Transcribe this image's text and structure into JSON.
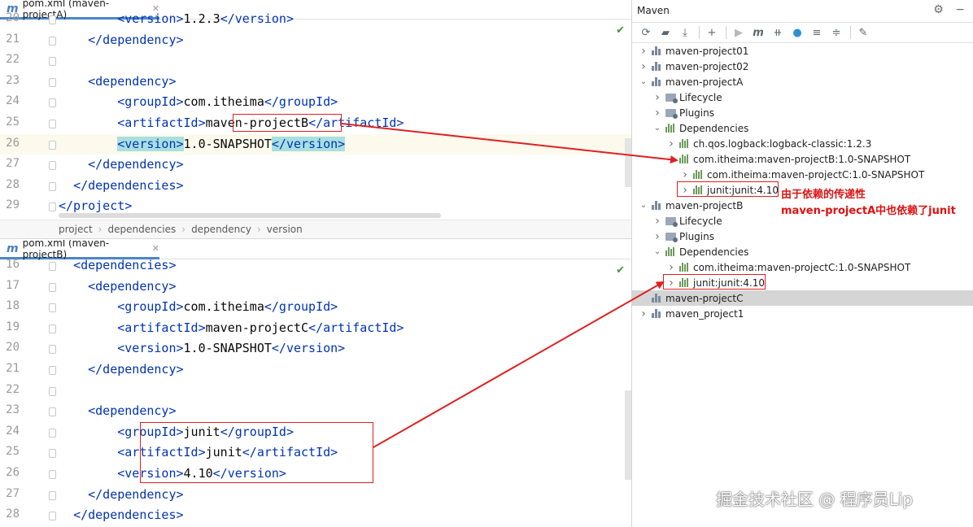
{
  "editor_a": {
    "tab_label": "pom.xml (maven-projectA)",
    "lines": [
      {
        "num": "20",
        "indent": "        ",
        "parts": [
          [
            "tag",
            "<version>"
          ],
          [
            "t",
            "1.2.3"
          ],
          [
            "tag",
            "</version>"
          ]
        ]
      },
      {
        "num": "21",
        "indent": "    ",
        "parts": [
          [
            "tag",
            "</dependency>"
          ]
        ]
      },
      {
        "num": "22",
        "indent": "",
        "parts": []
      },
      {
        "num": "23",
        "indent": "    ",
        "parts": [
          [
            "tag",
            "<dependency>"
          ]
        ]
      },
      {
        "num": "24",
        "indent": "        ",
        "parts": [
          [
            "tag",
            "<groupId>"
          ],
          [
            "t",
            "com.itheima"
          ],
          [
            "tag",
            "</groupId>"
          ]
        ]
      },
      {
        "num": "25",
        "indent": "        ",
        "parts": [
          [
            "tag",
            "<artifactId>"
          ],
          [
            "t",
            "maven-projectB"
          ],
          [
            "tag",
            "</artifactId>"
          ]
        ]
      },
      {
        "num": "26",
        "indent": "        ",
        "parts": [
          [
            "tagbg",
            "<version>"
          ],
          [
            "t",
            "1.0-SNAPSHOT"
          ],
          [
            "tagbg",
            "</version>"
          ]
        ]
      },
      {
        "num": "27",
        "indent": "    ",
        "parts": [
          [
            "tag",
            "</dependency>"
          ]
        ]
      },
      {
        "num": "28",
        "indent": "  ",
        "parts": [
          [
            "tag",
            "</dependencies>"
          ]
        ]
      },
      {
        "num": "29",
        "indent": "",
        "parts": [
          [
            "tag",
            "</project>"
          ]
        ]
      }
    ],
    "breadcrumb": [
      "project",
      "dependencies",
      "dependency",
      "version"
    ]
  },
  "editor_b": {
    "tab_label": "pom.xml (maven-projectB)",
    "lines": [
      {
        "num": "16",
        "indent": "  ",
        "parts": [
          [
            "tag",
            "<dependencies>"
          ]
        ]
      },
      {
        "num": "17",
        "indent": "    ",
        "parts": [
          [
            "tag",
            "<dependency>"
          ]
        ]
      },
      {
        "num": "18",
        "indent": "        ",
        "parts": [
          [
            "tag",
            "<groupId>"
          ],
          [
            "t",
            "com.itheima"
          ],
          [
            "tag",
            "</groupId>"
          ]
        ]
      },
      {
        "num": "19",
        "indent": "        ",
        "parts": [
          [
            "tag",
            "<artifactId>"
          ],
          [
            "t",
            "maven-projectC"
          ],
          [
            "tag",
            "</artifactId>"
          ]
        ]
      },
      {
        "num": "20",
        "indent": "        ",
        "parts": [
          [
            "tag",
            "<version>"
          ],
          [
            "t",
            "1.0-SNAPSHOT"
          ],
          [
            "tag",
            "</version>"
          ]
        ]
      },
      {
        "num": "21",
        "indent": "    ",
        "parts": [
          [
            "tag",
            "</dependency>"
          ]
        ]
      },
      {
        "num": "22",
        "indent": "",
        "parts": []
      },
      {
        "num": "23",
        "indent": "    ",
        "parts": [
          [
            "tag",
            "<dependency>"
          ]
        ]
      },
      {
        "num": "24",
        "indent": "        ",
        "parts": [
          [
            "tag",
            "<groupId>"
          ],
          [
            "t",
            "junit"
          ],
          [
            "tag",
            "</groupId>"
          ]
        ]
      },
      {
        "num": "25",
        "indent": "        ",
        "parts": [
          [
            "tag",
            "<artifactId>"
          ],
          [
            "t",
            "junit"
          ],
          [
            "tag",
            "</artifactId>"
          ]
        ]
      },
      {
        "num": "26",
        "indent": "        ",
        "parts": [
          [
            "tag",
            "<version>"
          ],
          [
            "t",
            "4.10"
          ],
          [
            "tag",
            "</version>"
          ]
        ]
      },
      {
        "num": "27",
        "indent": "    ",
        "parts": [
          [
            "tag",
            "</dependency>"
          ]
        ]
      },
      {
        "num": "28",
        "indent": "  ",
        "parts": [
          [
            "tag",
            "</dependencies>"
          ]
        ]
      }
    ]
  },
  "maven": {
    "title": "Maven",
    "toolbar_icons": [
      "reload-icon",
      "add-folder-icon",
      "download-icon",
      "plus-icon",
      "run-icon",
      "maven-goal-icon",
      "skip-tests-icon",
      "offline-icon",
      "collapse-icon",
      "expand-icon",
      "wrench-icon"
    ],
    "tree": [
      {
        "label": "maven-project01",
        "level": 0,
        "chev": ">",
        "icon": "module"
      },
      {
        "label": "maven-project02",
        "level": 0,
        "chev": ">",
        "icon": "module"
      },
      {
        "label": "maven-projectA",
        "level": 0,
        "chev": "v",
        "icon": "module"
      },
      {
        "label": "Lifecycle",
        "level": 1,
        "chev": ">",
        "icon": "folder"
      },
      {
        "label": "Plugins",
        "level": 1,
        "chev": ">",
        "icon": "folder"
      },
      {
        "label": "Dependencies",
        "level": 1,
        "chev": "v",
        "icon": "bars"
      },
      {
        "label": "ch.qos.logback:logback-classic:1.2.3",
        "level": 2,
        "chev": ">",
        "icon": "bars"
      },
      {
        "label": "com.itheima:maven-projectB:1.0-SNAPSHOT",
        "level": 2,
        "chev": "v",
        "icon": "bars"
      },
      {
        "label": "com.itheima:maven-projectC:1.0-SNAPSHOT",
        "level": 3,
        "chev": ">",
        "icon": "bars"
      },
      {
        "label": "junit:junit:4.10",
        "level": 3,
        "chev": ">",
        "icon": "bars"
      },
      {
        "label": "maven-projectB",
        "level": 0,
        "chev": "v",
        "icon": "module"
      },
      {
        "label": "Lifecycle",
        "level": 1,
        "chev": ">",
        "icon": "folder"
      },
      {
        "label": "Plugins",
        "level": 1,
        "chev": ">",
        "icon": "folder"
      },
      {
        "label": "Dependencies",
        "level": 1,
        "chev": "v",
        "icon": "bars"
      },
      {
        "label": "com.itheima:maven-projectC:1.0-SNAPSHOT",
        "level": 2,
        "chev": ">",
        "icon": "bars"
      },
      {
        "label": "junit:junit:4.10",
        "level": 2,
        "chev": ">",
        "icon": "bars"
      },
      {
        "label": "maven-projectC",
        "level": 0,
        "chev": "",
        "icon": "module",
        "selected": true
      },
      {
        "label": "maven_project1",
        "level": 0,
        "chev": ">",
        "icon": "module"
      }
    ]
  },
  "annotations": {
    "line1": "由于依赖的传递性",
    "line2": "maven-projectA中也依赖了junit"
  },
  "watermark": "掘金技术社区 @ 程序员Lip",
  "colors": {
    "tag": "#0033b3",
    "highlight_red": "#e02020",
    "selected_row": "#d5d5d5",
    "tab_underline": "#4a86c8"
  }
}
